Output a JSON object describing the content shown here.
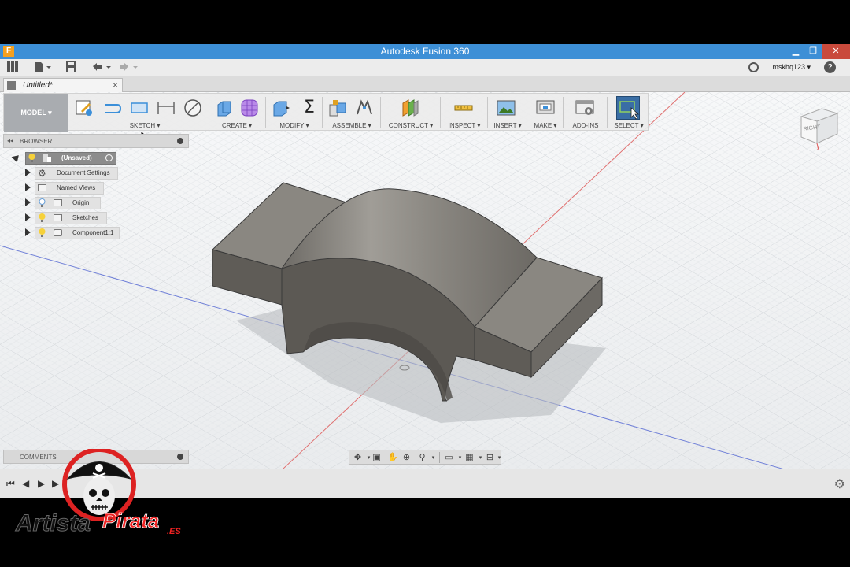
{
  "window": {
    "title": "Autodesk Fusion 360",
    "app_icon_letter": "F"
  },
  "quick_access": {
    "user": "mskhq123 ▾",
    "help": "?"
  },
  "tab": {
    "label": "Untitled*",
    "close": "×"
  },
  "toolbar": {
    "model_label": "MODEL ▾",
    "groups": {
      "sketch": "SKETCH ▾",
      "create": "CREATE ▾",
      "modify": "MODIFY ▾",
      "assemble": "ASSEMBLE ▾",
      "construct": "CONSTRUCT ▾",
      "inspect": "INSPECT ▾",
      "insert": "INSERT ▾",
      "make": "MAKE ▾",
      "addins": "ADD-INS",
      "select": "SELECT ▾"
    },
    "modify_sigma": "Σ"
  },
  "browser": {
    "header": "BROWSER",
    "collapse": "◂◂",
    "root": "(Unsaved)",
    "items": [
      {
        "label": "Document Settings",
        "icon": "gear-icon"
      },
      {
        "label": "Named Views",
        "icon": "folder-icon"
      },
      {
        "label": "Origin",
        "icon": "folder-icon"
      },
      {
        "label": "Sketches",
        "icon": "folder-icon"
      },
      {
        "label": "Component1:1",
        "icon": "component-icon"
      }
    ]
  },
  "viewcube": {
    "face": "RIGHT"
  },
  "comments": {
    "label": "COMMENTS"
  },
  "watermark": {
    "text_left": "Artista",
    "text_right": "Pirata",
    "suffix": ".ES"
  },
  "colors": {
    "titlebar": "#3d8fd6",
    "part_top": "#8a8780",
    "part_front": "#5f5c57",
    "axis_red": "#e06060",
    "axis_blue": "#6070d0",
    "select_active": "#3a6ea5"
  }
}
